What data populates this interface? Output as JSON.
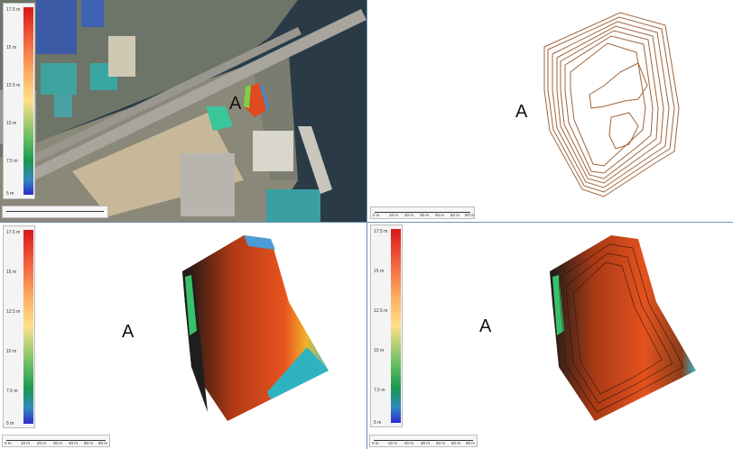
{
  "panel_label": "A",
  "legend_ticks": [
    "17.5 m",
    "15 m",
    "12.5 m",
    "10 m",
    "7.5 m",
    "5 m"
  ],
  "scale_ticks": [
    "0 m",
    "10 m",
    "20 m",
    "30 m",
    "40 m",
    "50 m",
    "60 m"
  ],
  "colors": {
    "contour": "#a0653a",
    "divider": "#6f8fb6",
    "water": "#263845"
  },
  "panels": [
    {
      "name": "aerial-photo-panel",
      "content": "satellite imagery with colored elevation overlay"
    },
    {
      "name": "contour-lines-panel",
      "content": "brown contour lines"
    },
    {
      "name": "elevation-model-panel",
      "content": "colored elevation surface"
    },
    {
      "name": "elevation-contour-panel",
      "content": "colored elevation surface with contour lines"
    }
  ]
}
